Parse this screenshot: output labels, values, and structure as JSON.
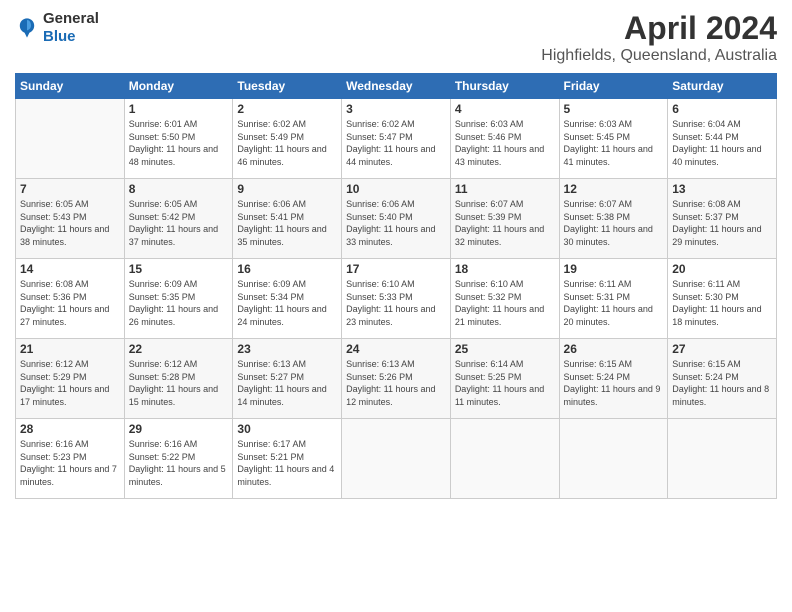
{
  "logo": {
    "general": "General",
    "blue": "Blue"
  },
  "header": {
    "title": "April 2024",
    "subtitle": "Highfields, Queensland, Australia"
  },
  "days_of_week": [
    "Sunday",
    "Monday",
    "Tuesday",
    "Wednesday",
    "Thursday",
    "Friday",
    "Saturday"
  ],
  "weeks": [
    [
      {
        "day": "",
        "sunrise": "",
        "sunset": "",
        "daylight": ""
      },
      {
        "day": "1",
        "sunrise": "Sunrise: 6:01 AM",
        "sunset": "Sunset: 5:50 PM",
        "daylight": "Daylight: 11 hours and 48 minutes."
      },
      {
        "day": "2",
        "sunrise": "Sunrise: 6:02 AM",
        "sunset": "Sunset: 5:49 PM",
        "daylight": "Daylight: 11 hours and 46 minutes."
      },
      {
        "day": "3",
        "sunrise": "Sunrise: 6:02 AM",
        "sunset": "Sunset: 5:47 PM",
        "daylight": "Daylight: 11 hours and 44 minutes."
      },
      {
        "day": "4",
        "sunrise": "Sunrise: 6:03 AM",
        "sunset": "Sunset: 5:46 PM",
        "daylight": "Daylight: 11 hours and 43 minutes."
      },
      {
        "day": "5",
        "sunrise": "Sunrise: 6:03 AM",
        "sunset": "Sunset: 5:45 PM",
        "daylight": "Daylight: 11 hours and 41 minutes."
      },
      {
        "day": "6",
        "sunrise": "Sunrise: 6:04 AM",
        "sunset": "Sunset: 5:44 PM",
        "daylight": "Daylight: 11 hours and 40 minutes."
      }
    ],
    [
      {
        "day": "7",
        "sunrise": "Sunrise: 6:05 AM",
        "sunset": "Sunset: 5:43 PM",
        "daylight": "Daylight: 11 hours and 38 minutes."
      },
      {
        "day": "8",
        "sunrise": "Sunrise: 6:05 AM",
        "sunset": "Sunset: 5:42 PM",
        "daylight": "Daylight: 11 hours and 37 minutes."
      },
      {
        "day": "9",
        "sunrise": "Sunrise: 6:06 AM",
        "sunset": "Sunset: 5:41 PM",
        "daylight": "Daylight: 11 hours and 35 minutes."
      },
      {
        "day": "10",
        "sunrise": "Sunrise: 6:06 AM",
        "sunset": "Sunset: 5:40 PM",
        "daylight": "Daylight: 11 hours and 33 minutes."
      },
      {
        "day": "11",
        "sunrise": "Sunrise: 6:07 AM",
        "sunset": "Sunset: 5:39 PM",
        "daylight": "Daylight: 11 hours and 32 minutes."
      },
      {
        "day": "12",
        "sunrise": "Sunrise: 6:07 AM",
        "sunset": "Sunset: 5:38 PM",
        "daylight": "Daylight: 11 hours and 30 minutes."
      },
      {
        "day": "13",
        "sunrise": "Sunrise: 6:08 AM",
        "sunset": "Sunset: 5:37 PM",
        "daylight": "Daylight: 11 hours and 29 minutes."
      }
    ],
    [
      {
        "day": "14",
        "sunrise": "Sunrise: 6:08 AM",
        "sunset": "Sunset: 5:36 PM",
        "daylight": "Daylight: 11 hours and 27 minutes."
      },
      {
        "day": "15",
        "sunrise": "Sunrise: 6:09 AM",
        "sunset": "Sunset: 5:35 PM",
        "daylight": "Daylight: 11 hours and 26 minutes."
      },
      {
        "day": "16",
        "sunrise": "Sunrise: 6:09 AM",
        "sunset": "Sunset: 5:34 PM",
        "daylight": "Daylight: 11 hours and 24 minutes."
      },
      {
        "day": "17",
        "sunrise": "Sunrise: 6:10 AM",
        "sunset": "Sunset: 5:33 PM",
        "daylight": "Daylight: 11 hours and 23 minutes."
      },
      {
        "day": "18",
        "sunrise": "Sunrise: 6:10 AM",
        "sunset": "Sunset: 5:32 PM",
        "daylight": "Daylight: 11 hours and 21 minutes."
      },
      {
        "day": "19",
        "sunrise": "Sunrise: 6:11 AM",
        "sunset": "Sunset: 5:31 PM",
        "daylight": "Daylight: 11 hours and 20 minutes."
      },
      {
        "day": "20",
        "sunrise": "Sunrise: 6:11 AM",
        "sunset": "Sunset: 5:30 PM",
        "daylight": "Daylight: 11 hours and 18 minutes."
      }
    ],
    [
      {
        "day": "21",
        "sunrise": "Sunrise: 6:12 AM",
        "sunset": "Sunset: 5:29 PM",
        "daylight": "Daylight: 11 hours and 17 minutes."
      },
      {
        "day": "22",
        "sunrise": "Sunrise: 6:12 AM",
        "sunset": "Sunset: 5:28 PM",
        "daylight": "Daylight: 11 hours and 15 minutes."
      },
      {
        "day": "23",
        "sunrise": "Sunrise: 6:13 AM",
        "sunset": "Sunset: 5:27 PM",
        "daylight": "Daylight: 11 hours and 14 minutes."
      },
      {
        "day": "24",
        "sunrise": "Sunrise: 6:13 AM",
        "sunset": "Sunset: 5:26 PM",
        "daylight": "Daylight: 11 hours and 12 minutes."
      },
      {
        "day": "25",
        "sunrise": "Sunrise: 6:14 AM",
        "sunset": "Sunset: 5:25 PM",
        "daylight": "Daylight: 11 hours and 11 minutes."
      },
      {
        "day": "26",
        "sunrise": "Sunrise: 6:15 AM",
        "sunset": "Sunset: 5:24 PM",
        "daylight": "Daylight: 11 hours and 9 minutes."
      },
      {
        "day": "27",
        "sunrise": "Sunrise: 6:15 AM",
        "sunset": "Sunset: 5:24 PM",
        "daylight": "Daylight: 11 hours and 8 minutes."
      }
    ],
    [
      {
        "day": "28",
        "sunrise": "Sunrise: 6:16 AM",
        "sunset": "Sunset: 5:23 PM",
        "daylight": "Daylight: 11 hours and 7 minutes."
      },
      {
        "day": "29",
        "sunrise": "Sunrise: 6:16 AM",
        "sunset": "Sunset: 5:22 PM",
        "daylight": "Daylight: 11 hours and 5 minutes."
      },
      {
        "day": "30",
        "sunrise": "Sunrise: 6:17 AM",
        "sunset": "Sunset: 5:21 PM",
        "daylight": "Daylight: 11 hours and 4 minutes."
      },
      {
        "day": "",
        "sunrise": "",
        "sunset": "",
        "daylight": ""
      },
      {
        "day": "",
        "sunrise": "",
        "sunset": "",
        "daylight": ""
      },
      {
        "day": "",
        "sunrise": "",
        "sunset": "",
        "daylight": ""
      },
      {
        "day": "",
        "sunrise": "",
        "sunset": "",
        "daylight": ""
      }
    ]
  ]
}
